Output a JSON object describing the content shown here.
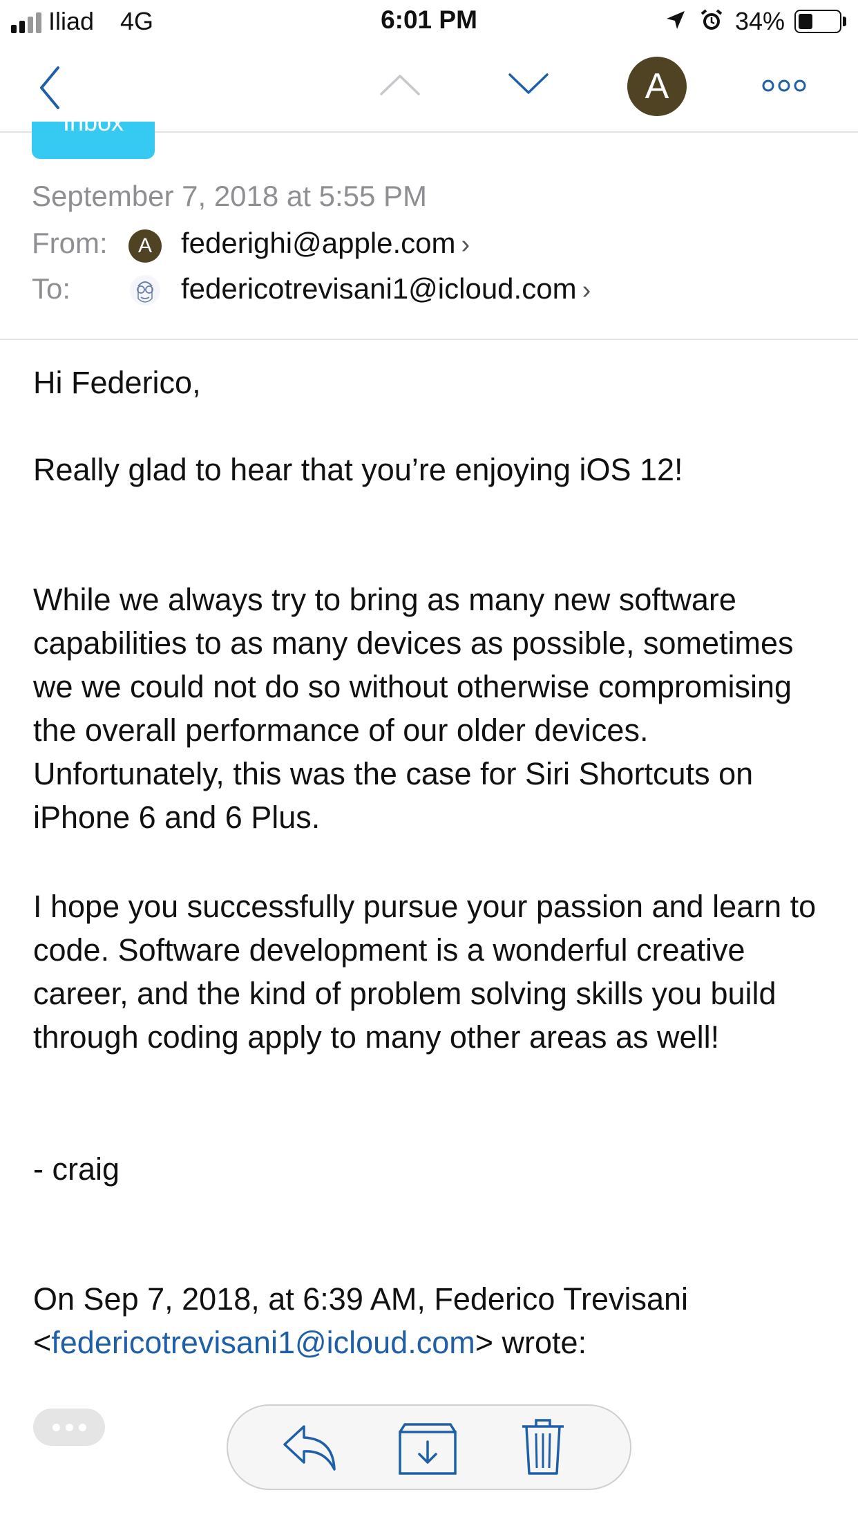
{
  "status_bar": {
    "carrier": "Iliad",
    "network": "4G",
    "time": "6:01 PM",
    "battery": "34%",
    "icons": [
      "signal-icon",
      "location-icon",
      "alarm-icon",
      "battery-icon"
    ]
  },
  "nav": {
    "account_initial": "A",
    "icons": [
      "back-chevron-icon",
      "up-chevron-icon",
      "down-chevron-icon",
      "more-icon"
    ],
    "accent_color": "#1f5fa8"
  },
  "header": {
    "mailbox_tag": "Inbox",
    "date": "September 7, 2018 at 5:55 PM",
    "from_label": "From:",
    "from_initial": "A",
    "from_address": "federighi@apple.com",
    "to_label": "To:",
    "to_address": "federicotrevisani1@icloud.com",
    "chevron": "›"
  },
  "body": {
    "greeting": "Hi Federico,",
    "line1": "Really glad to hear that you’re enjoying iOS 12!",
    "paragraph1": "While we always try to bring as many new software capabilities to as many devices as possible, sometimes we we could not do so without otherwise compromising the overall performance of our older devices.  Unfortunately, this was the case for Siri Shortcuts on iPhone 6 and 6 Plus.",
    "paragraph2": "I hope you successfully pursue your passion and learn to code.  Software development is a wonderful creative career, and the kind of problem solving skills you build through coding apply to many other areas as well!",
    "signature": "- craig",
    "quote_intro": "On Sep 7, 2018, at 6:39 AM, Federico Trevisani",
    "quote_lt": "<",
    "quote_email": "federicotrevisani1@icloud.com",
    "quote_end": "> wrote:"
  },
  "toolbar": {
    "icons": [
      "ellipsis-icon",
      "reply-icon",
      "archive-icon",
      "trash-icon"
    ]
  },
  "colors": {
    "inbox_tag": "#36c9f1",
    "avatar": "#4f4324",
    "secondary_text": "#8e8e93",
    "link": "#1f5fa8"
  }
}
